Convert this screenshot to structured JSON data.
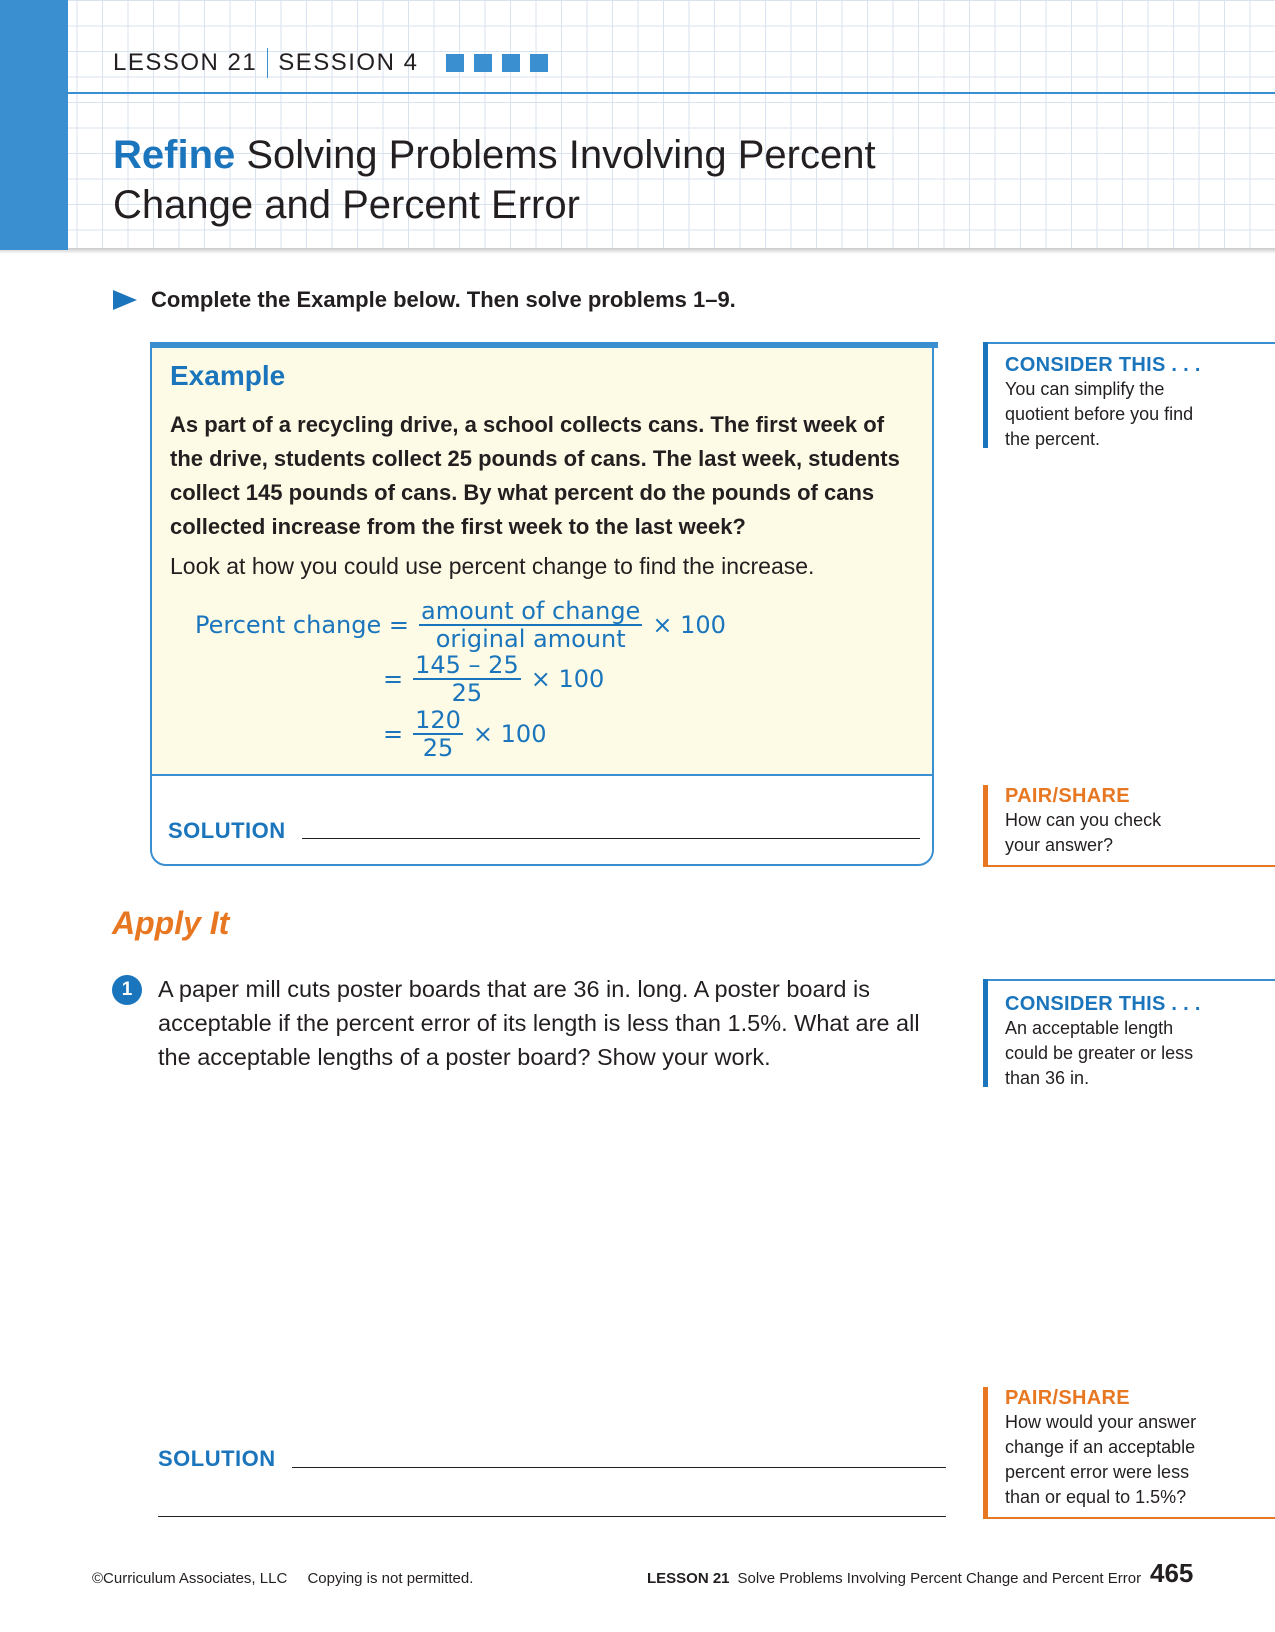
{
  "header": {
    "lesson": "LESSON 21",
    "session": "SESSION 4",
    "title_bold": "Refine",
    "title_rest": " Solving Problems Involving Percent Change and Percent Error"
  },
  "directive": "Complete the Example below. Then solve problems 1–9.",
  "example": {
    "heading": "Example",
    "problem": "As part of a recycling drive, a school collects cans. The first week of the drive, students collect 25 pounds of cans. The last week, students collect 145 pounds of cans. By what percent do the pounds of cans collected increase from the first week to the last week?",
    "look": "Look at how you could use percent change to find the increase.",
    "math": {
      "lhs": "Percent change =",
      "f1_num": "amount of change",
      "f1_den": "original amount",
      "times": "× 100",
      "eq": "=",
      "f2_num": "145 – 25",
      "f2_den": "25",
      "f3_num": "120",
      "f3_den": "25"
    },
    "solution_label": "SOLUTION"
  },
  "sidebars": {
    "consider1_title": "CONSIDER THIS . . .",
    "consider1_text": "You can simplify the quotient before you find the percent.",
    "pair1_title": "PAIR/SHARE",
    "pair1_text": "How can you check your answer?",
    "consider2_title": "CONSIDER THIS . . .",
    "consider2_text": "An acceptable length could be greater or less than 36 in.",
    "pair2_title": "PAIR/SHARE",
    "pair2_text": "How would your answer change if an acceptable percent error were less than or equal to 1.5%?"
  },
  "apply": {
    "heading": "Apply It",
    "q1_number": "1",
    "q1_text": "A paper mill cuts poster boards that are 36 in. long. A poster board is acceptable if the percent error of its length is less than 1.5%. What are all the acceptable lengths of a poster board?  Show your work.",
    "solution_label": "SOLUTION"
  },
  "footer": {
    "copyright": "©Curriculum Associates, LLC",
    "copying": "Copying is not permitted.",
    "lesson": "LESSON 21",
    "lesson_title": "Solve Problems Involving Percent Change and Percent Error",
    "page": "465"
  },
  "colors": {
    "blue": "#1b75bc",
    "light_blue": "#3a8fd1",
    "orange": "#e87722",
    "example_bg": "#fdfbe5"
  }
}
